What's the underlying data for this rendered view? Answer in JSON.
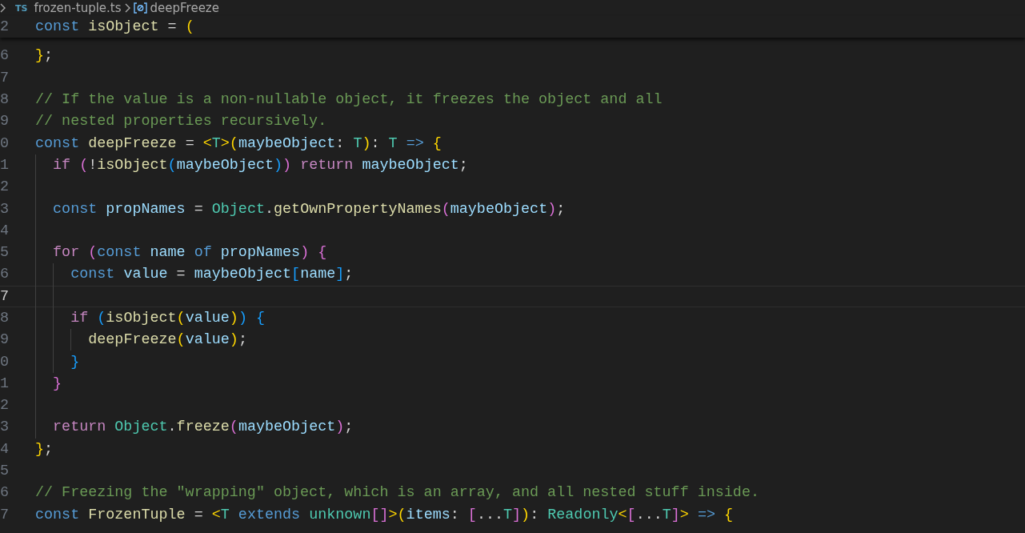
{
  "breadcrumb": {
    "file_type": "TS",
    "items": [
      "frozen-tuple.ts",
      "deepFreeze"
    ]
  },
  "sticky_line": {
    "number": "2",
    "tokens": [
      {
        "text": "const",
        "kind": "keyword"
      },
      {
        "text": " isObject",
        "kind": "function"
      },
      {
        "text": " =",
        "kind": "plain"
      },
      {
        "text": " (",
        "kind": "bracket1"
      }
    ]
  },
  "lines": [
    {
      "number": "6",
      "current": false,
      "tokens": [
        {
          "text": "}",
          "kind": "bracket1"
        },
        {
          "text": ";",
          "kind": "plain"
        }
      ]
    },
    {
      "number": "7",
      "current": false
    },
    {
      "number": "8",
      "current": false,
      "tokens": [
        {
          "text": "// If the value is a non-nullable object, it freezes the object and all",
          "kind": "comment"
        }
      ]
    },
    {
      "number": "9",
      "current": false,
      "tokens": [
        {
          "text": "// nested properties recursively.",
          "kind": "comment"
        }
      ]
    },
    {
      "number": "0",
      "current": false,
      "tokens": [
        {
          "text": "const",
          "kind": "keyword"
        },
        {
          "text": " deepFreeze",
          "kind": "function"
        },
        {
          "text": " =",
          "kind": "plain"
        },
        {
          "text": " <",
          "kind": "bracket1"
        },
        {
          "text": "T",
          "kind": "type"
        },
        {
          "text": ">",
          "kind": "bracket1"
        },
        {
          "text": "(",
          "kind": "bracket1"
        },
        {
          "text": "maybeObject",
          "kind": "variable"
        },
        {
          "text": ":",
          "kind": "plain"
        },
        {
          "text": " T",
          "kind": "type"
        },
        {
          "text": ")",
          "kind": "bracket1"
        },
        {
          "text": ":",
          "kind": "plain"
        },
        {
          "text": " T",
          "kind": "type"
        },
        {
          "text": " =>",
          "kind": "keyword"
        },
        {
          "text": " {",
          "kind": "bracket1"
        }
      ]
    },
    {
      "number": "1",
      "current": false,
      "tokens": [
        {
          "text": "  if",
          "kind": "control"
        },
        {
          "text": " (",
          "kind": "bracket2"
        },
        {
          "text": "!",
          "kind": "plain"
        },
        {
          "text": "isObject",
          "kind": "function"
        },
        {
          "text": "(",
          "kind": "bracket3"
        },
        {
          "text": "maybeObject",
          "kind": "variable"
        },
        {
          "text": ")",
          "kind": "bracket3"
        },
        {
          "text": ")",
          "kind": "bracket2"
        },
        {
          "text": " return",
          "kind": "control"
        },
        {
          "text": " maybeObject",
          "kind": "variable"
        },
        {
          "text": ";",
          "kind": "plain"
        }
      ]
    },
    {
      "number": "2",
      "current": false
    },
    {
      "number": "3",
      "current": false,
      "tokens": [
        {
          "text": "  const",
          "kind": "keyword"
        },
        {
          "text": " propNames",
          "kind": "variable"
        },
        {
          "text": " =",
          "kind": "plain"
        },
        {
          "text": " Object",
          "kind": "type"
        },
        {
          "text": ".",
          "kind": "plain"
        },
        {
          "text": "getOwnPropertyNames",
          "kind": "function"
        },
        {
          "text": "(",
          "kind": "bracket2"
        },
        {
          "text": "maybeObject",
          "kind": "variable"
        },
        {
          "text": ")",
          "kind": "bracket2"
        },
        {
          "text": ";",
          "kind": "plain"
        }
      ]
    },
    {
      "number": "4",
      "current": false
    },
    {
      "number": "5",
      "current": false,
      "tokens": [
        {
          "text": "  for",
          "kind": "control"
        },
        {
          "text": " (",
          "kind": "bracket2"
        },
        {
          "text": "const",
          "kind": "keyword"
        },
        {
          "text": " name",
          "kind": "variable"
        },
        {
          "text": " of",
          "kind": "keyword"
        },
        {
          "text": " propNames",
          "kind": "variable"
        },
        {
          "text": ")",
          "kind": "bracket2"
        },
        {
          "text": " {",
          "kind": "bracket2"
        }
      ]
    },
    {
      "number": "6",
      "current": false,
      "tokens": [
        {
          "text": "    const",
          "kind": "keyword"
        },
        {
          "text": " value",
          "kind": "variable"
        },
        {
          "text": " =",
          "kind": "plain"
        },
        {
          "text": " maybeObject",
          "kind": "variable"
        },
        {
          "text": "[",
          "kind": "bracket3"
        },
        {
          "text": "name",
          "kind": "variable"
        },
        {
          "text": "]",
          "kind": "bracket3"
        },
        {
          "text": ";",
          "kind": "plain"
        }
      ]
    },
    {
      "number": "7",
      "current": true
    },
    {
      "number": "8",
      "current": false,
      "tokens": [
        {
          "text": "    if",
          "kind": "control"
        },
        {
          "text": " (",
          "kind": "bracket3"
        },
        {
          "text": "isObject",
          "kind": "function"
        },
        {
          "text": "(",
          "kind": "bracket1"
        },
        {
          "text": "value",
          "kind": "variable"
        },
        {
          "text": ")",
          "kind": "bracket1"
        },
        {
          "text": ")",
          "kind": "bracket3"
        },
        {
          "text": " {",
          "kind": "bracket3"
        }
      ]
    },
    {
      "number": "9",
      "current": false,
      "tokens": [
        {
          "text": "      deepFreeze",
          "kind": "function"
        },
        {
          "text": "(",
          "kind": "bracket1"
        },
        {
          "text": "value",
          "kind": "variable"
        },
        {
          "text": ")",
          "kind": "bracket1"
        },
        {
          "text": ";",
          "kind": "plain"
        }
      ]
    },
    {
      "number": "0",
      "current": false,
      "tokens": [
        {
          "text": "    }",
          "kind": "bracket3"
        }
      ]
    },
    {
      "number": "1",
      "current": false,
      "tokens": [
        {
          "text": "  }",
          "kind": "bracket2"
        }
      ]
    },
    {
      "number": "2",
      "current": false
    },
    {
      "number": "3",
      "current": false,
      "tokens": [
        {
          "text": "  return",
          "kind": "control"
        },
        {
          "text": " Object",
          "kind": "type"
        },
        {
          "text": ".",
          "kind": "plain"
        },
        {
          "text": "freeze",
          "kind": "function"
        },
        {
          "text": "(",
          "kind": "bracket2"
        },
        {
          "text": "maybeObject",
          "kind": "variable"
        },
        {
          "text": ")",
          "kind": "bracket2"
        },
        {
          "text": ";",
          "kind": "plain"
        }
      ]
    },
    {
      "number": "4",
      "current": false,
      "tokens": [
        {
          "text": "}",
          "kind": "bracket1"
        },
        {
          "text": ";",
          "kind": "plain"
        }
      ]
    },
    {
      "number": "5",
      "current": false
    },
    {
      "number": "6",
      "current": false,
      "tokens": [
        {
          "text": "// Freezing the \"wrapping\" object, which is an array, and all nested stuff inside.",
          "kind": "comment"
        }
      ]
    },
    {
      "number": "7",
      "current": false,
      "tokens": [
        {
          "text": "const",
          "kind": "keyword"
        },
        {
          "text": " FrozenTuple",
          "kind": "function"
        },
        {
          "text": " =",
          "kind": "plain"
        },
        {
          "text": " <",
          "kind": "bracket1"
        },
        {
          "text": "T",
          "kind": "type"
        },
        {
          "text": " extends",
          "kind": "keyword"
        },
        {
          "text": " unknown",
          "kind": "type"
        },
        {
          "text": "[]",
          "kind": "bracket2"
        },
        {
          "text": ">",
          "kind": "bracket1"
        },
        {
          "text": "(",
          "kind": "bracket1"
        },
        {
          "text": "items",
          "kind": "variable"
        },
        {
          "text": ":",
          "kind": "plain"
        },
        {
          "text": " [",
          "kind": "bracket2"
        },
        {
          "text": "...",
          "kind": "plain"
        },
        {
          "text": "T",
          "kind": "type"
        },
        {
          "text": "]",
          "kind": "bracket2"
        },
        {
          "text": ")",
          "kind": "bracket1"
        },
        {
          "text": ":",
          "kind": "plain"
        },
        {
          "text": " Readonly",
          "kind": "type"
        },
        {
          "text": "<",
          "kind": "bracket1"
        },
        {
          "text": "[",
          "kind": "bracket2"
        },
        {
          "text": "...",
          "kind": "plain"
        },
        {
          "text": "T",
          "kind": "type"
        },
        {
          "text": "]",
          "kind": "bracket2"
        },
        {
          "text": ">",
          "kind": "bracket1"
        },
        {
          "text": " =>",
          "kind": "keyword"
        },
        {
          "text": " {",
          "kind": "bracket1"
        }
      ]
    }
  ]
}
